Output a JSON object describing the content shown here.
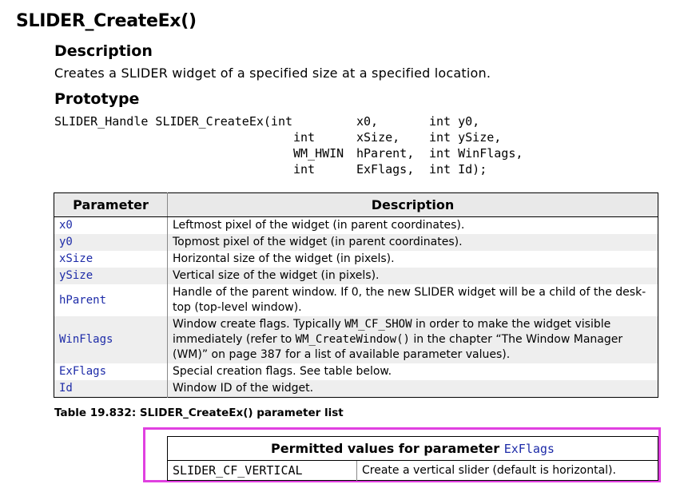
{
  "title": "SLIDER_CreateEx()",
  "description": {
    "heading": "Description",
    "text": "Creates a SLIDER widget of a specified size at a specified location."
  },
  "prototype": {
    "heading": "Prototype",
    "lines": [
      [
        "SLIDER_Handle SLIDER_CreateEx(int",
        "x0,",
        "int y0,"
      ],
      [
        "int",
        "xSize,",
        "int ySize,"
      ],
      [
        "WM_HWIN",
        "hParent,",
        "int WinFlags,"
      ],
      [
        "int",
        "ExFlags,",
        "int Id);"
      ]
    ]
  },
  "param_table": {
    "headers": [
      "Parameter",
      "Description"
    ],
    "rows": [
      {
        "param": "x0",
        "desc": "Leftmost pixel of the widget (in parent coordinates)."
      },
      {
        "param": "y0",
        "desc": "Topmost pixel of the widget (in parent coordinates)."
      },
      {
        "param": "xSize",
        "desc": "Horizontal size of the widget (in pixels)."
      },
      {
        "param": "ySize",
        "desc": "Vertical size of the widget (in pixels)."
      },
      {
        "param": "hParent",
        "desc_l1": "Handle of the parent window. If 0, the new SLIDER widget will be a child of the desk-",
        "desc_l2": "top (top-level window)."
      },
      {
        "param": "WinFlags",
        "d1a": "Window create flags. Typically ",
        "d1b": "WM_CF_SHOW",
        "d1c": " in order to make the widget visible",
        "d2a": "immediately (refer to ",
        "d2b": "WM_CreateWindow()",
        "d2c": " in the chapter “The Window Manager",
        "d3": "(WM)” on page 387 for a list of available parameter values)."
      },
      {
        "param": "ExFlags",
        "desc": "Special creation flags. See table below."
      },
      {
        "param": "Id",
        "desc": "Window ID of the widget."
      }
    ],
    "caption": "Table 19.832: SLIDER_CreateEx() parameter list"
  },
  "flags_table": {
    "header_text": "Permitted values for parameter ",
    "header_param": "ExFlags",
    "rows": [
      {
        "value": "SLIDER_CF_VERTICAL",
        "desc": "Create a vertical slider (default is horizontal)."
      }
    ]
  }
}
